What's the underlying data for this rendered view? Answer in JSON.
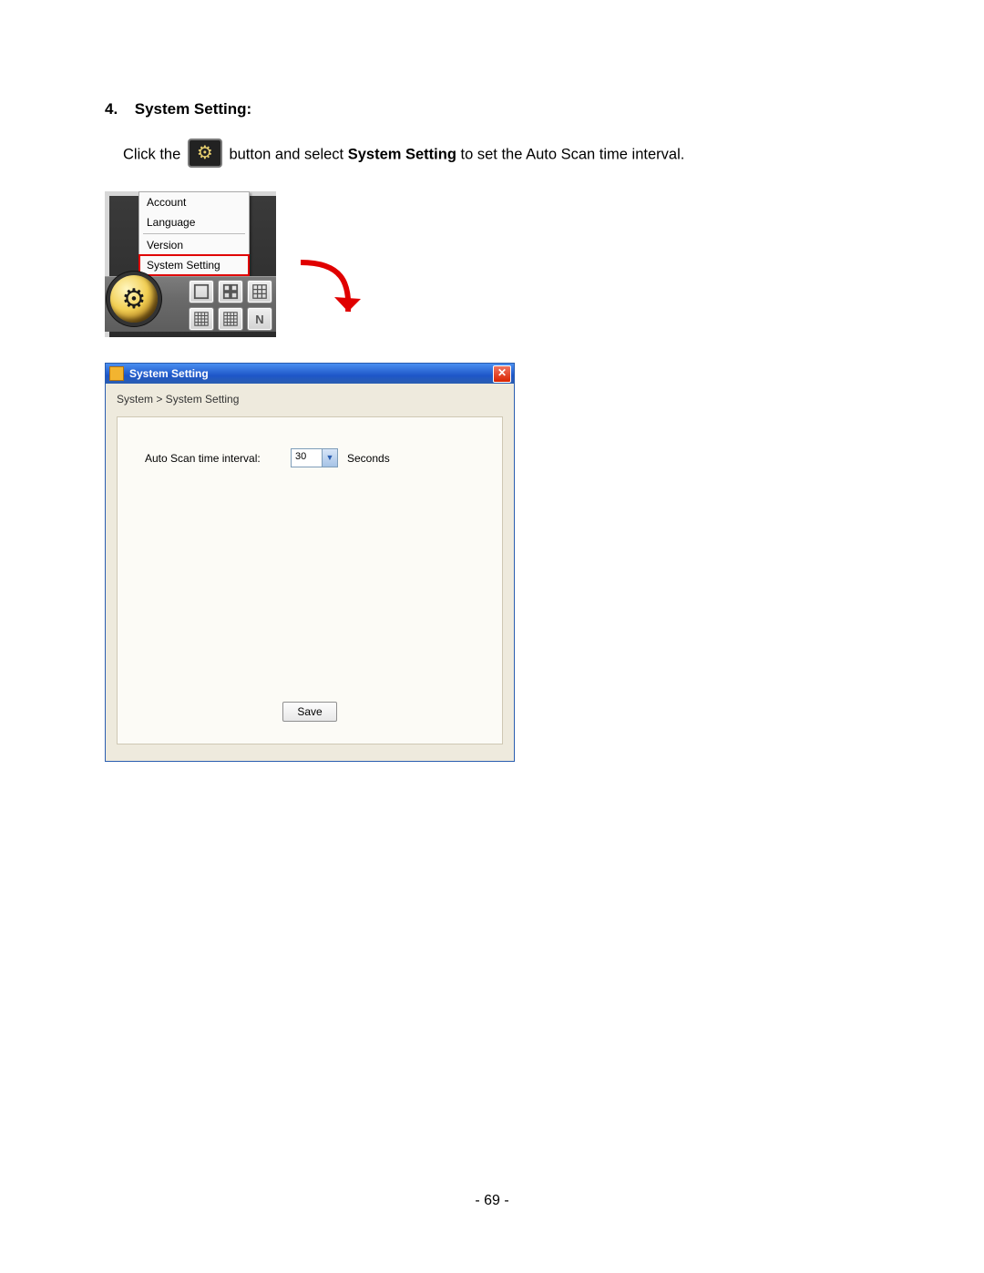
{
  "heading": {
    "number": "4.",
    "title": "System Setting:"
  },
  "intro": {
    "pre": "Click the ",
    "mid": " button and select ",
    "bold": "System Setting",
    "post": " to set the Auto Scan time interval."
  },
  "menu": {
    "items": [
      "Account",
      "Language",
      "Version",
      "System Setting"
    ]
  },
  "dialog": {
    "title": "System Setting",
    "breadcrumb": "System > System Setting",
    "fieldLabel": "Auto Scan time interval:",
    "fieldValue": "30",
    "unit": "Seconds",
    "saveLabel": "Save"
  },
  "pageNumber": "- 69 -"
}
